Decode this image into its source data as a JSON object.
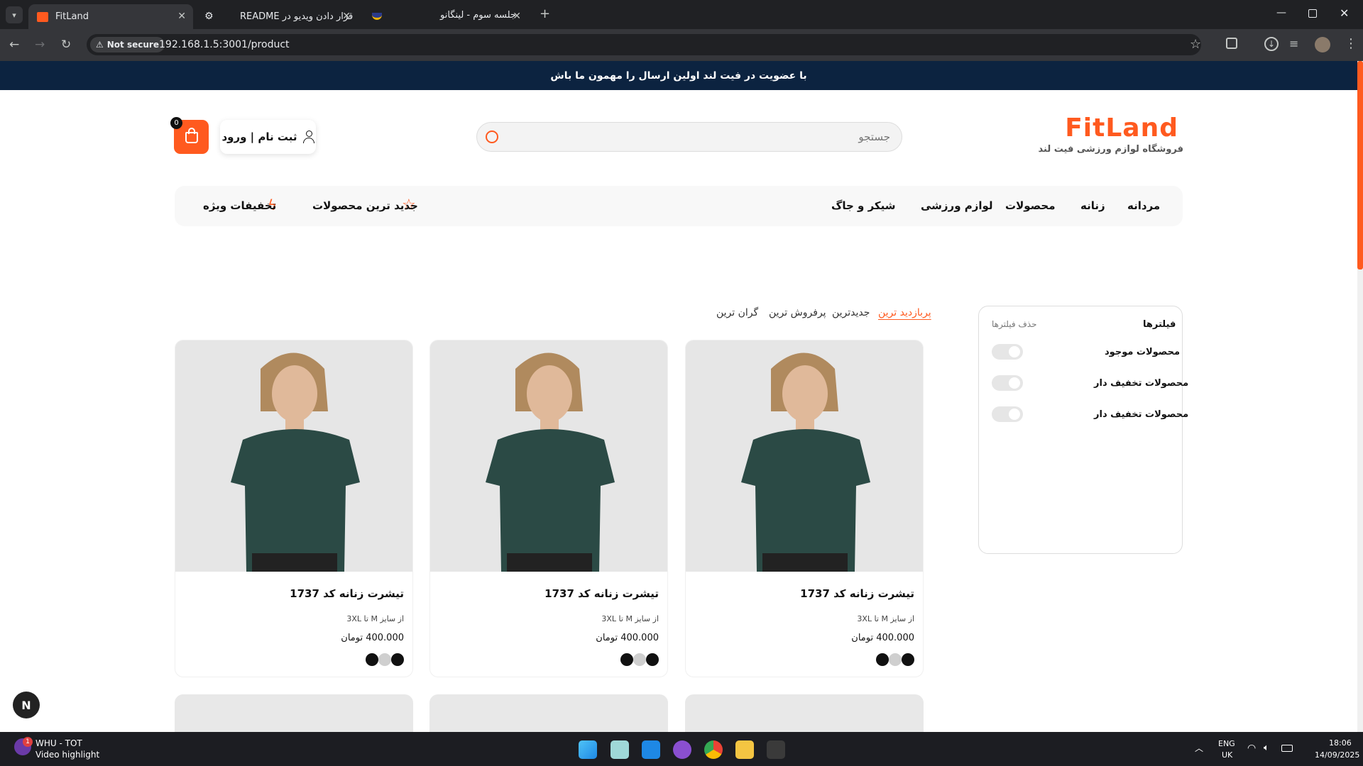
{
  "browser": {
    "tabs": [
      {
        "title": "FitLand",
        "active": true
      },
      {
        "title": "قرار دادن ویدیو در README",
        "active": false
      },
      {
        "title": "جلسه سوم - لینگانو",
        "active": false
      }
    ],
    "not_secure_label": "Not secure",
    "url": "192.168.1.5:3001/product"
  },
  "site": {
    "promo": "با عضویت در فیت لند اولین ارسال را مهمون ما باش",
    "logo": "FitLand",
    "logo_subtitle": "فروشگاه لوازم ورزشی فیت لند",
    "search_placeholder": "جستجو",
    "login_label": "ثبت نام | ورود",
    "cart_count": "0",
    "menu": [
      "مردانه",
      "زنانه",
      "محصولات",
      "لوازم ورزشی",
      "شیکر و جاگ"
    ],
    "menu_special": [
      "جدید ترین محصولات",
      "تخفیفات ویژه"
    ],
    "accent_color": "#ff5a1f",
    "navy_color": "#0c2340"
  },
  "filters": {
    "title": "فیلترها",
    "clear_label": "حذف فیلترها",
    "items": [
      "محصولات موجود",
      "محصولات تخفیف دار",
      "محصولات تخفیف دار"
    ]
  },
  "sort": {
    "options": [
      "پربازدید ترین",
      "جدیدترین",
      "پرفروش ترین",
      "گران ترین"
    ],
    "active_index": 0
  },
  "products": [
    {
      "name": "تیشرت زنانه کد 1737",
      "sizes": "از سایز M تا 3XL",
      "price": "400.000 تومان",
      "colors": [
        "#111111",
        "#cfcfcf",
        "#111111"
      ]
    },
    {
      "name": "تیشرت زنانه کد 1737",
      "sizes": "از سایز M تا 3XL",
      "price": "400.000 تومان",
      "colors": [
        "#111111",
        "#cfcfcf",
        "#111111"
      ]
    },
    {
      "name": "تیشرت زنانه کد 1737",
      "sizes": "از سایز M تا 3XL",
      "price": "400.000 تومان",
      "colors": [
        "#111111",
        "#cfcfcf",
        "#111111"
      ]
    }
  ],
  "nextjs_badge": "N",
  "taskbar": {
    "media_title": "WHU - TOT",
    "media_subtitle": "Video highlight",
    "notification_count": "1",
    "lang_primary": "ENG",
    "lang_secondary": "UK",
    "time": "18:06",
    "date": "14/09/2025"
  }
}
